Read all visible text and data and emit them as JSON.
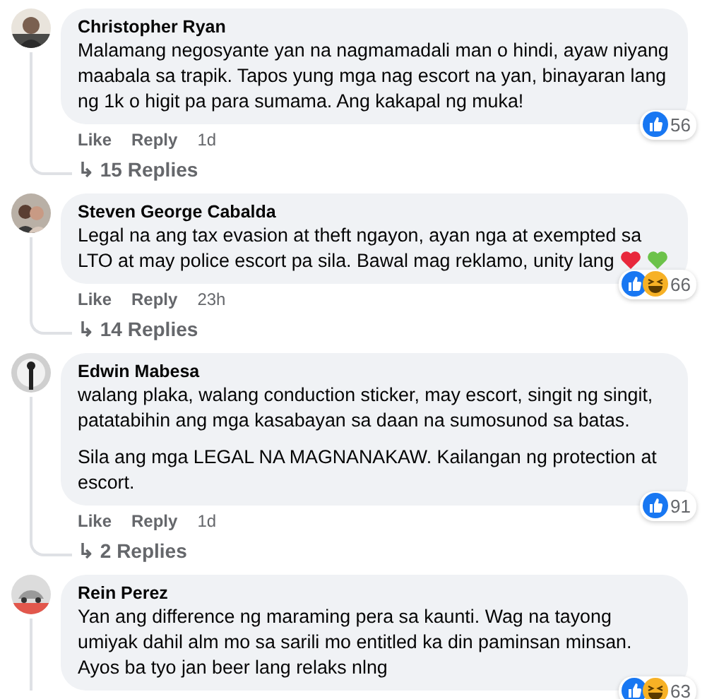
{
  "comments": [
    {
      "author": "Christopher Ryan",
      "avatar": {
        "kind": "picture"
      },
      "paragraphs": [
        "Malamang negosyante yan na nagmamadali man o hindi, ayaw niyang maabala sa trapik. Tapos yung mga nag escort na yan, binayaran lang ng 1k o higit pa para sumama. Ang kakapal ng muka!"
      ],
      "reactions": [
        {
          "kind": "like"
        }
      ],
      "reaction_count": "56",
      "actions": {
        "like": "Like",
        "reply": "Reply",
        "time": "1d"
      },
      "replies": {
        "arrow": "↳",
        "label": "15 Replies"
      }
    },
    {
      "author": "Steven George Cabalda",
      "avatar": {
        "kind": "picture"
      },
      "paragraphs": [
        "Legal na ang tax evasion at theft ngayon, ayan nga at exempted sa LTO at may police escort pa sila. Bawal mag reklamo, unity lang"
      ],
      "emojis": [
        {
          "kind": "heart",
          "color": "#e8283c"
        },
        {
          "kind": "heart",
          "color": "#6cc24a"
        }
      ],
      "reactions": [
        {
          "kind": "like"
        },
        {
          "kind": "haha"
        }
      ],
      "reaction_count": "66",
      "actions": {
        "like": "Like",
        "reply": "Reply",
        "time": "23h"
      },
      "replies": {
        "arrow": "↳",
        "label": "14 Replies"
      }
    },
    {
      "author": "Edwin Mabesa",
      "avatar": {
        "kind": "picture"
      },
      "paragraphs": [
        "walang plaka, walang conduction sticker, may escort, singit ng singit, patatabihin ang mga kasabayan sa daan na sumosunod sa batas.",
        "Sila ang mga LEGAL NA MAGNANAKAW. Kailangan ng protection at escort."
      ],
      "reactions": [
        {
          "kind": "like"
        }
      ],
      "reaction_count": "91",
      "actions": {
        "like": "Like",
        "reply": "Reply",
        "time": "1d"
      },
      "replies": {
        "arrow": "↳",
        "label": "2 Replies"
      }
    },
    {
      "author": "Rein Perez",
      "avatar": {
        "kind": "picture"
      },
      "paragraphs": [
        "Yan ang difference ng maraming pera sa kaunti. Wag na tayong umiyak dahil alm mo sa sarili mo entitled ka din paminsan minsan. Ayos ba tyo jan beer lang relaks nlng"
      ],
      "reactions": [
        {
          "kind": "like"
        },
        {
          "kind": "haha"
        }
      ],
      "reaction_count": "63"
    }
  ]
}
